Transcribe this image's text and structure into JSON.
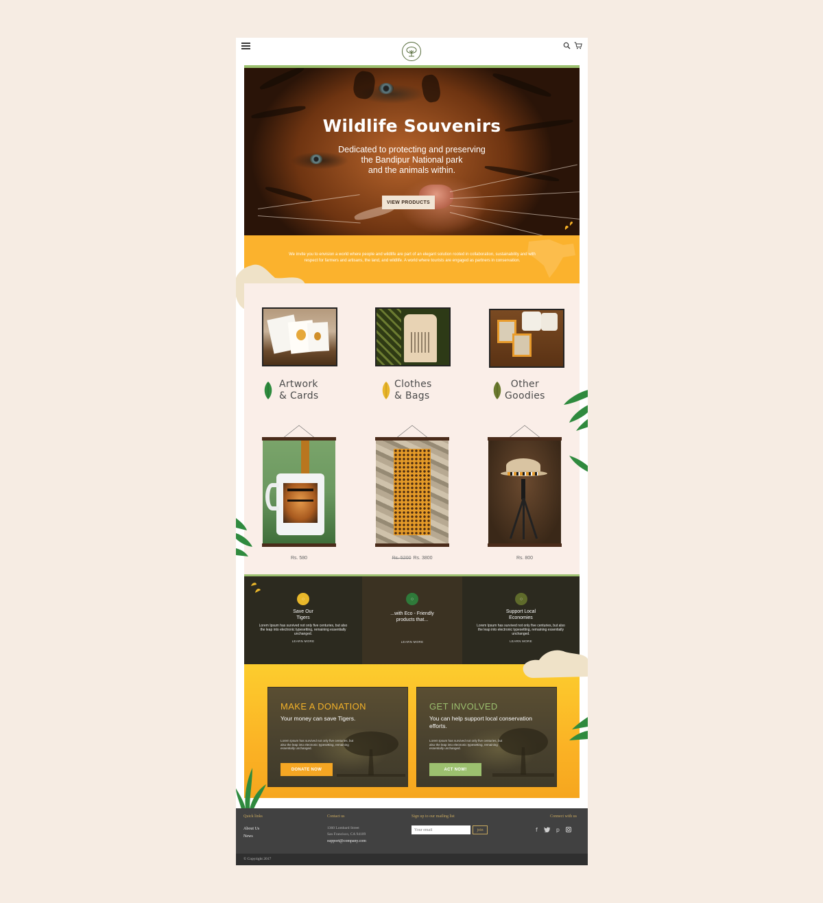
{
  "header": {
    "menu_icon": "hamburger-icon",
    "logo_icon": "tree-logo-icon",
    "search_icon": "search-icon",
    "cart_icon": "cart-icon"
  },
  "hero": {
    "title": "Wildlife Souvenirs",
    "subtitle_lines": [
      "Dedicated to protecting and preserving",
      "the Bandipur National park",
      "and the animals within."
    ],
    "button_label": "VIEW PRODUCTS"
  },
  "intro": {
    "text": "We invite you to envision a world where people and wildlife are part of an elegant solution rooted in collaboration, sustainability and with respect for farmers and artisans, the land, and wildlife. A world where tourists are engaged as partners in conservation."
  },
  "categories": [
    {
      "line1": "Artwork",
      "line2": "& Cards",
      "leaf_color": "#2e8b3e"
    },
    {
      "line1": "Clothes",
      "line2": "& Bags",
      "leaf_color": "#e8b52a"
    },
    {
      "line1": "Other",
      "line2": "Goodies",
      "leaf_color": "#6b7a2f"
    }
  ],
  "products": [
    {
      "old_price": "",
      "price": "Rs. 580"
    },
    {
      "old_price": "Rs. 5200",
      "price": "Rs. 3800"
    },
    {
      "old_price": "",
      "price": "Rs. 800"
    }
  ],
  "mission": [
    {
      "title_lines": [
        "Save Our",
        "Tigers"
      ],
      "text": "Lorem Ipsum has survived not only five centuries, but also the leap into electronic typesetting, remaining essentially unchanged.",
      "link": "LEARN MORE",
      "circle_color": "#e9b82a"
    },
    {
      "title_lines": [
        "...with Eco - Friendly",
        "products that..."
      ],
      "text": "",
      "link": "LEARN MORE",
      "circle_color": "#2f7a3a"
    },
    {
      "title_lines": [
        "Support Local",
        "Economies"
      ],
      "text": "Lorem Ipsum has survived not only five centuries, but also the leap into electronic typesetting, remaining essentially unchanged.",
      "link": "LEARN MORE",
      "circle_color": "#5f6b2b"
    }
  ],
  "donation": {
    "title": "MAKE A DONATION",
    "subtitle": "Your money can save Tigers.",
    "text": "Lorem Ipsum has survived not only five centuries, but also the leap into electronic typesetting, remaining essentially unchanged.",
    "button": "DONATE NOW",
    "title_color": "#f5b328",
    "button_color": "#f5a623"
  },
  "involved": {
    "title": "GET INVOLVED",
    "subtitle": "You can help support local conservation efforts.",
    "text": "Lorem Ipsum has survived not only five centuries, but also the leap into electronic typesetting, remaining essentially unchanged.",
    "button": "ACT NOW!",
    "title_color": "#9cc06f",
    "button_color": "#9cc06f"
  },
  "footer": {
    "quick_links_heading": "Quick links",
    "quick_links": [
      "About Us",
      "News"
    ],
    "contact_heading": "Contact us",
    "address_lines": [
      "1360 Lombard Street",
      "San Francisco, CA 94109"
    ],
    "email": "support@company.com",
    "mailing_heading": "Sign up to our mailing list",
    "email_placeholder": "Your email",
    "join_label": "join",
    "connect_heading": "Connect with us",
    "social": [
      "f",
      "t",
      "p",
      "i"
    ],
    "copyright": "© Copyright 2017"
  }
}
